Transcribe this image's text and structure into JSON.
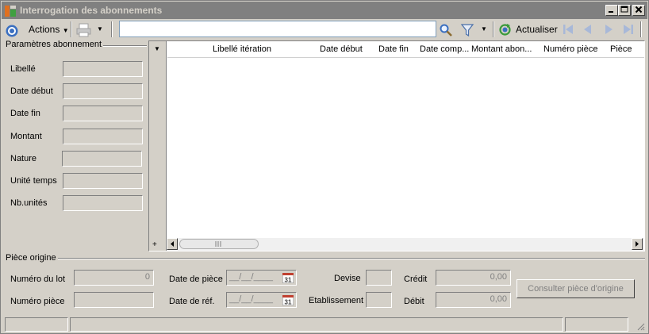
{
  "window": {
    "title": "Interrogation des abonnements",
    "buttons": {
      "minimize": "_",
      "maximize": "□",
      "close": "✕"
    }
  },
  "toolbar": {
    "actions_label": "Actions",
    "search_value": "",
    "refresh_label": "Actualiser"
  },
  "params": {
    "group_label": "Paramètres abonnement",
    "fields": [
      {
        "label": "Libellé",
        "value": ""
      },
      {
        "label": "Date début",
        "value": ""
      },
      {
        "label": "Date fin",
        "value": ""
      },
      {
        "label": "Montant",
        "value": ""
      },
      {
        "label": "Nature",
        "value": ""
      },
      {
        "label": "Unité temps",
        "value": ""
      },
      {
        "label": "Nb.unités",
        "value": ""
      }
    ]
  },
  "grid": {
    "columns": [
      "Libellé itération",
      "Date début",
      "Date fin",
      "Date comp...",
      "Montant abon...",
      "Numéro pièce",
      "Pièce"
    ],
    "rows": [],
    "expand_symbol": "+"
  },
  "origin": {
    "group_label": "Pièce origine",
    "lot_label": "Numéro du lot",
    "lot_value": "0",
    "piece_number_label": "Numéro  pièce",
    "piece_number_value": "",
    "piece_date_label": "Date de pièce",
    "piece_date_value": "__/__/____",
    "ref_date_label": "Date de réf.",
    "ref_date_value": "__/__/____",
    "calendar_day": "31",
    "currency_label": "Devise",
    "currency_value": "",
    "establishment_label": "Etablissement",
    "establishment_value": "",
    "credit_label": "Crédit",
    "credit_value": "0,00",
    "debit_label": "Débit",
    "debit_value": "0,00",
    "consult_button": "Consulter pièce d'origine"
  },
  "colors": {
    "window_bg": "#d4d0c8",
    "titlebar_bg": "#808080",
    "disabled_text": "#808080",
    "nav_arrow": "#a8b8d8",
    "refresh_icon": "#3a9a3a",
    "search_icon": "#3a6fc0"
  }
}
